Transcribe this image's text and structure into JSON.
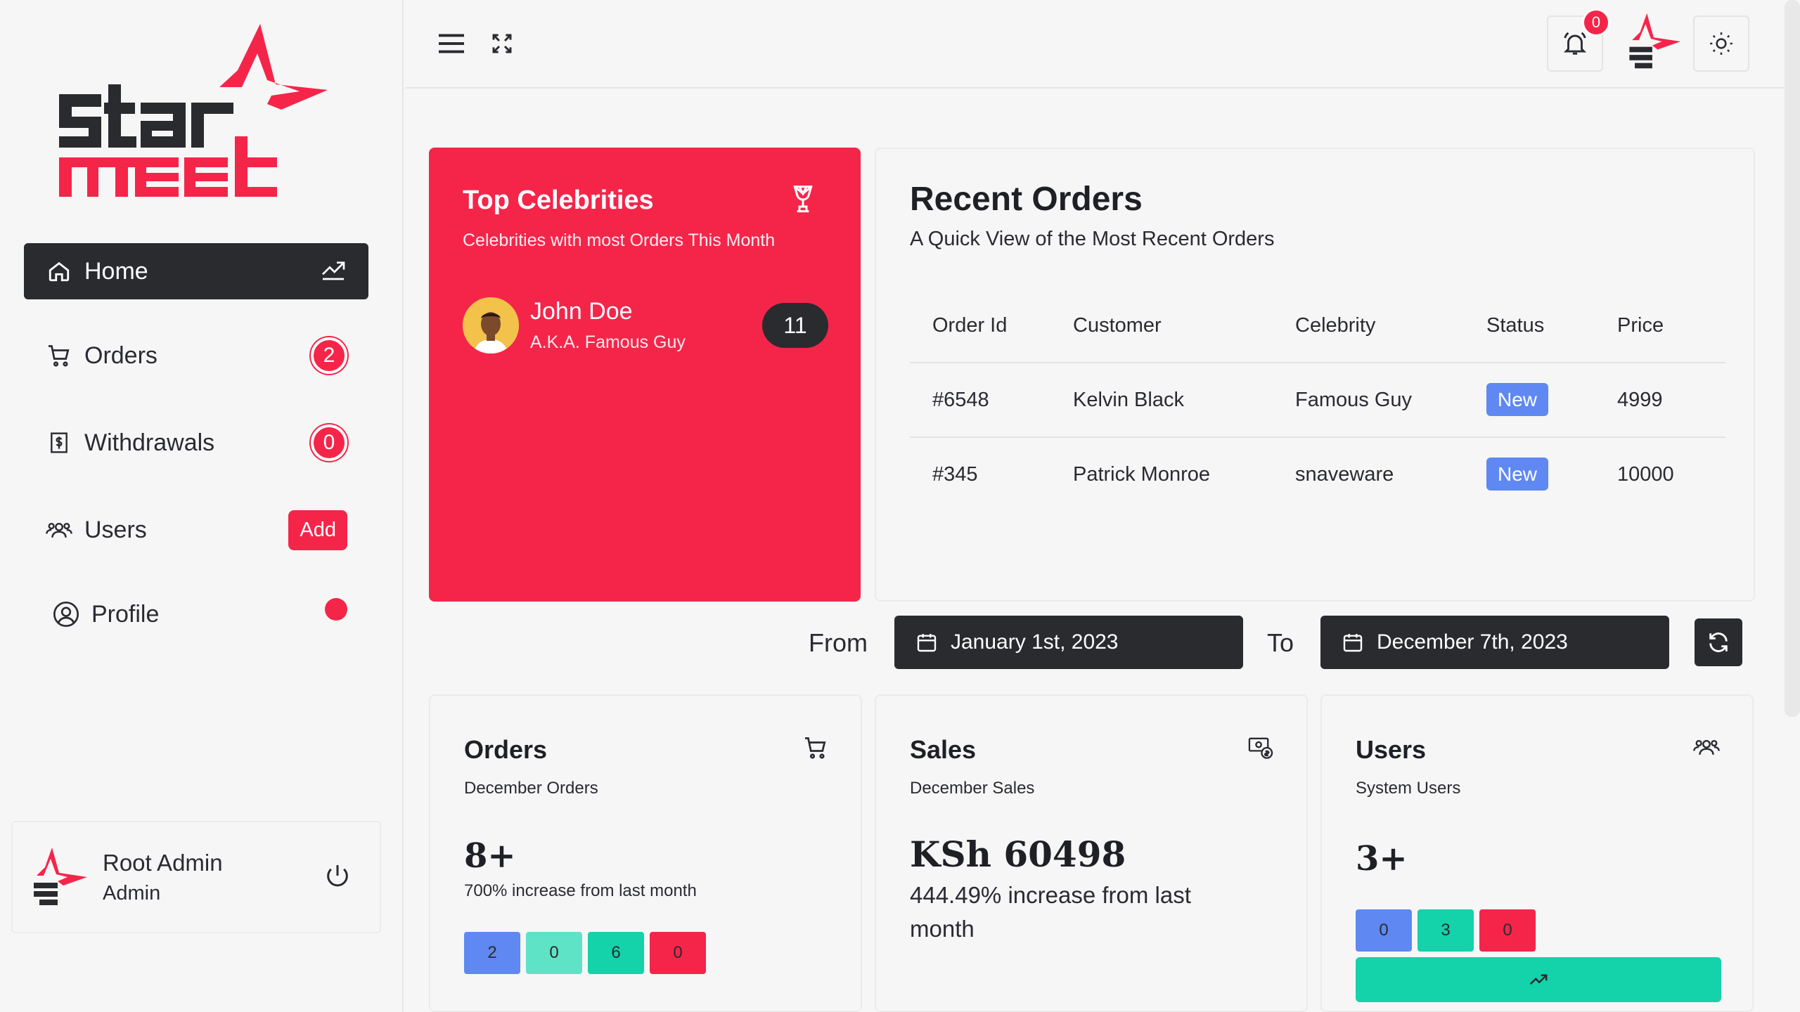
{
  "brand": {
    "logo_line1": "star",
    "logo_line2": "meet"
  },
  "sidebar": {
    "items": [
      {
        "label": "Home"
      },
      {
        "label": "Orders",
        "badge": "2"
      },
      {
        "label": "Withdrawals",
        "badge": "0"
      },
      {
        "label": "Users",
        "action": "Add"
      },
      {
        "label": "Profile"
      }
    ],
    "user": {
      "name": "Root Admin",
      "role": "Admin"
    }
  },
  "topbar": {
    "notification_count": "0"
  },
  "top_celebrities": {
    "title": "Top Celebrities",
    "subtitle": "Celebrities with most Orders This Month",
    "celebrity": {
      "name": "John Doe",
      "aka": "A.K.A. Famous Guy",
      "orders": "11"
    }
  },
  "recent_orders": {
    "title": "Recent Orders",
    "subtitle": "A Quick View of the Most Recent Orders",
    "columns": [
      "Order Id",
      "Customer",
      "Celebrity",
      "Status",
      "Price"
    ],
    "rows": [
      {
        "id": "#6548",
        "customer": "Kelvin Black",
        "celebrity": "Famous Guy",
        "status": "New",
        "price": "4999"
      },
      {
        "id": "#345",
        "customer": "Patrick Monroe",
        "celebrity": "snaveware",
        "status": "New",
        "price": "10000"
      }
    ]
  },
  "filter": {
    "from_label": "From",
    "from_date": "January 1st, 2023",
    "to_label": "To",
    "to_date": "December 7th, 2023"
  },
  "stats": {
    "orders": {
      "title": "Orders",
      "subtitle": "December Orders",
      "value": "8+",
      "change": "700% increase from last month",
      "chips": [
        "2",
        "0",
        "6",
        "0"
      ]
    },
    "sales": {
      "title": "Sales",
      "subtitle": "December Sales",
      "value": "KSh 60498",
      "change": "444.49% increase from last month"
    },
    "users": {
      "title": "Users",
      "subtitle": "System Users",
      "value": "3+",
      "chips": [
        "0",
        "3",
        "0"
      ]
    }
  },
  "colors": {
    "accent": "#f5254a",
    "dark": "#2a2b2f",
    "blue": "#5f88f2",
    "teal_light": "#5fe3c7",
    "teal": "#14d2a9",
    "red": "#f5254a"
  }
}
